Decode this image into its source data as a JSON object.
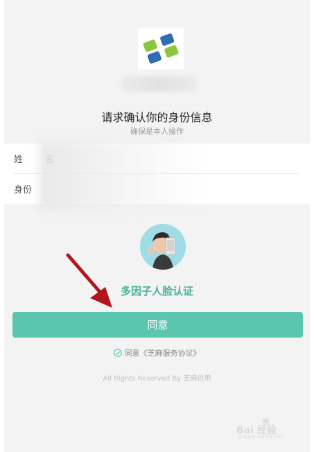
{
  "header": {
    "logo_icon": "zhima-credit-logo-icon",
    "title": "请求确认你的身份信息",
    "subtitle": "确保是本人操作"
  },
  "form": {
    "name_label": "姓 名",
    "name_value": "",
    "id_label": "身份",
    "id_value": ""
  },
  "verification": {
    "avatar_icon": "face-selfie-avatar-icon",
    "title": "多因子人脸认证"
  },
  "actions": {
    "agree_label": "同意",
    "agreement_check_icon": "check-circle-icon",
    "agreement_text": "同意《芝麻服务协议》"
  },
  "footer": {
    "text": "All Rights Reserved By 芝麻信用"
  },
  "annotation": {
    "arrow_icon": "red-arrow-icon"
  },
  "watermark": {
    "brand": "Bai 经验",
    "site": "jingyan.baidu.com"
  },
  "colors": {
    "accent": "#5ac6ad",
    "accent_text": "#47b59a",
    "background": "#f3f3f3",
    "arrow": "#b2151c"
  }
}
